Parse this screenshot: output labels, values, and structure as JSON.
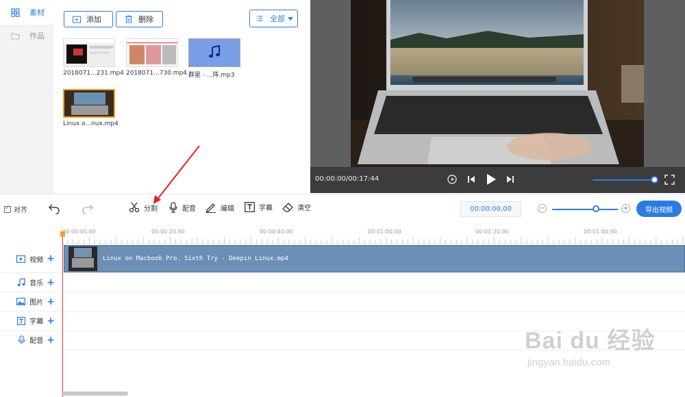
{
  "nav": {
    "items": [
      {
        "label": "素材",
        "icon": "grid-icon",
        "active": true
      },
      {
        "label": "作品",
        "icon": "folder-icon",
        "active": false
      }
    ]
  },
  "library": {
    "add_label": "添加",
    "delete_label": "删除",
    "filter_label": "全部",
    "items": [
      {
        "name": "2018071...231.mp4",
        "kind": "video"
      },
      {
        "name": "2018071...730.mp4",
        "kind": "video"
      },
      {
        "name": "群星 - ...阵.mp3",
        "kind": "audio"
      },
      {
        "name": "Linux o...nux.mp4",
        "kind": "video",
        "selected": true
      }
    ]
  },
  "preview": {
    "time": "00:00:00/00:17:44",
    "volume_fraction": 1.0
  },
  "toolbar": {
    "align_label": "对齐",
    "split_label": "分割",
    "dub_label": "配音",
    "edit_label": "编辑",
    "subtitle_label": "字幕",
    "clear_label": "清空",
    "timecode": "00:00:00,00",
    "zoom_fraction": 0.66,
    "export_label": "导出视频"
  },
  "timeline": {
    "ruler_ticks": [
      "00:00:00,00",
      "00:00:20,00",
      "00:00:40,00",
      "00:01:00,00",
      "00:01:20,00",
      "00:01:40,00"
    ],
    "tracks": [
      {
        "label": "视频",
        "icon": "video-icon"
      },
      {
        "label": "音乐",
        "icon": "music-icon"
      },
      {
        "label": "图片",
        "icon": "image-icon"
      },
      {
        "label": "字幕",
        "icon": "text-icon"
      },
      {
        "label": "配音",
        "icon": "mic-icon"
      }
    ],
    "clip_name": "Linux on Macbook Pro. Sixth Try - Deepin Linux.mp4"
  },
  "watermark": {
    "main": "Bai du 经验",
    "sub": "jingyan.baidu.com"
  },
  "colors": {
    "accent": "#2c7be5",
    "clip": "#6b8fb5",
    "playhead": "#e04040"
  }
}
